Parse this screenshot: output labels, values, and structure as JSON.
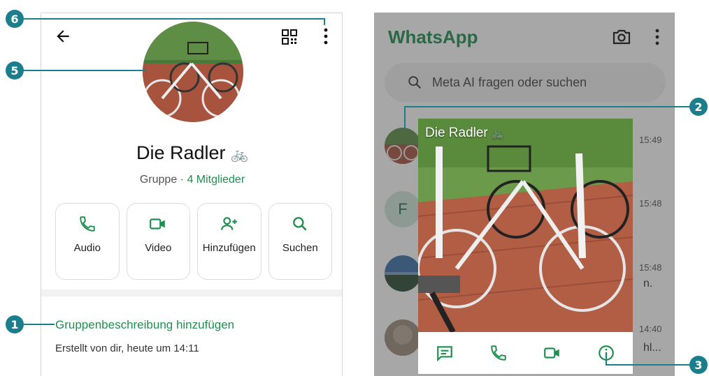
{
  "left": {
    "group_name": "Die Radler",
    "group_emoji": "🚲",
    "group_type": "Gruppe",
    "separator": " · ",
    "members": "4 Mitglieder",
    "actions": [
      {
        "label": "Audio",
        "icon": "phone-icon"
      },
      {
        "label": "Video",
        "icon": "video-icon"
      },
      {
        "label": "Hinzufügen",
        "icon": "add-person-icon"
      },
      {
        "label": "Suchen",
        "icon": "search-icon"
      }
    ],
    "add_description": "Gruppenbeschreibung hinzufügen",
    "created_info": "Erstellt von dir, heute um 14:11"
  },
  "right": {
    "app_title": "WhatsApp",
    "search_placeholder": "Meta AI fragen oder suchen",
    "chats": [
      {
        "time": "15:49",
        "avatar": "bike-photo",
        "snippet": ""
      },
      {
        "time": "15:48",
        "avatar": "letter-F",
        "letter": "F",
        "snippet": ""
      },
      {
        "time": "15:48",
        "avatar": "landscape-photo",
        "snippet": "n."
      },
      {
        "time": "14:40",
        "avatar": "blurred-photo",
        "snippet": "hl..."
      }
    ],
    "popup": {
      "title": "Die Radler",
      "title_emoji": "🚲",
      "actions": [
        "message-icon",
        "phone-icon",
        "video-icon",
        "info-icon"
      ]
    }
  },
  "callouts": [
    "1",
    "2",
    "3",
    "5",
    "6"
  ],
  "colors": {
    "accent": "#1e8f4f",
    "callout": "#1b7e8c"
  }
}
